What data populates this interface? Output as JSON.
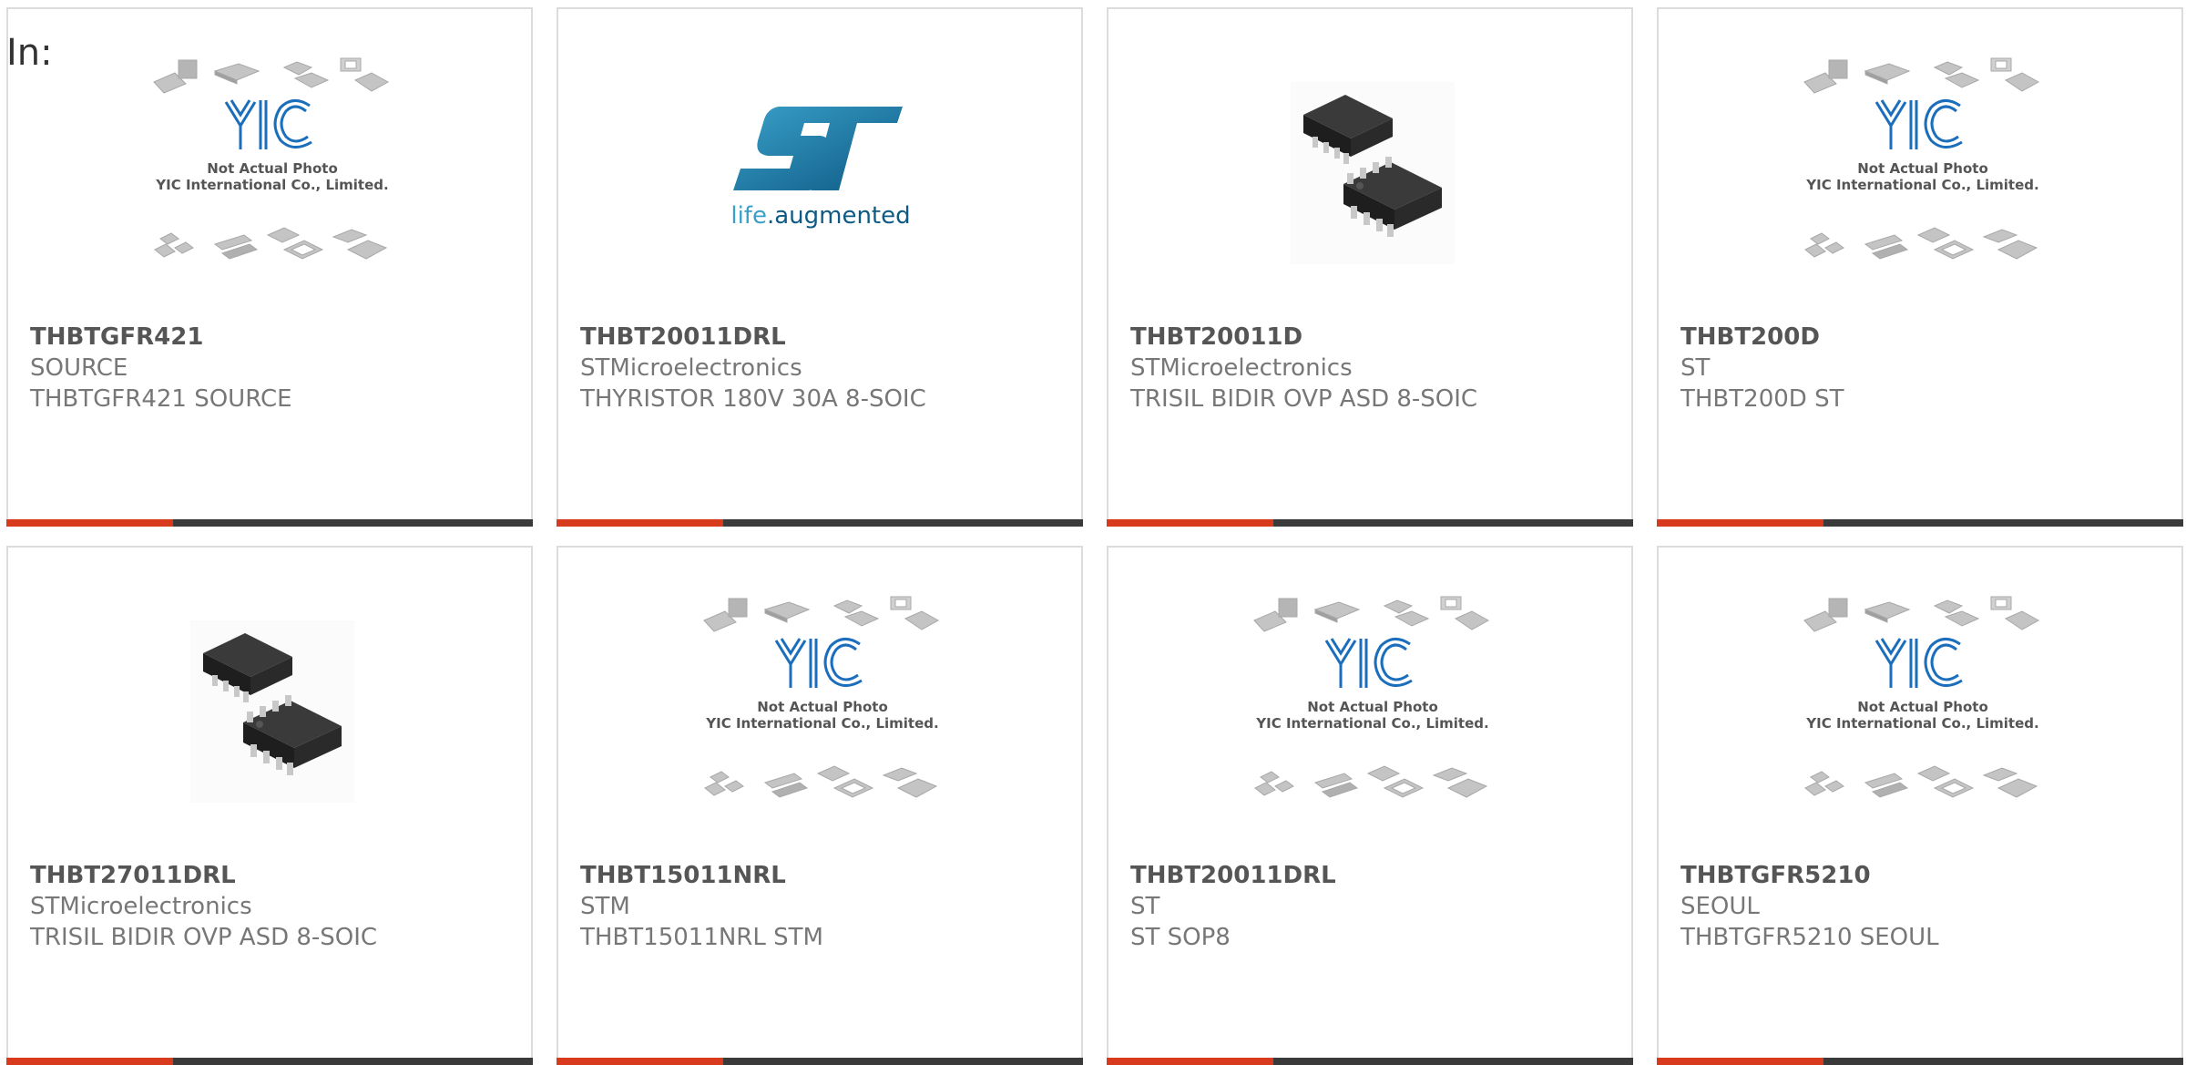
{
  "header": {
    "in_label": "In:"
  },
  "placeholder_text": {
    "line1": "Not Actual Photo",
    "line2": "YIC International Co., Limited."
  },
  "st_logo_tagline": {
    "life": "life",
    "augmented": ".augmented"
  },
  "colors": {
    "accent": "#d83a1e",
    "bar_dark": "#3a3a3a",
    "part_number": "#555555",
    "secondary_text": "#777777",
    "yic_blue": "#1a6ebc",
    "st_blue": "#1d6f9c"
  },
  "products": [
    {
      "part_number": "THBTGFR421",
      "manufacturer": "SOURCE",
      "description": "THBTGFR421 SOURCE",
      "image": "yic-placeholder"
    },
    {
      "part_number": "THBT20011DRL",
      "manufacturer": "STMicroelectronics",
      "description": "THYRISTOR 180V 30A 8-SOIC",
      "image": "st-logo"
    },
    {
      "part_number": "THBT20011D",
      "manufacturer": "STMicroelectronics",
      "description": "TRISIL BIDIR OVP ASD 8-SOIC",
      "image": "soic-chip"
    },
    {
      "part_number": "THBT200D",
      "manufacturer": "ST",
      "description": "THBT200D ST",
      "image": "yic-placeholder"
    },
    {
      "part_number": "THBT27011DRL",
      "manufacturer": "STMicroelectronics",
      "description": "TRISIL BIDIR OVP ASD 8-SOIC",
      "image": "soic-chip"
    },
    {
      "part_number": "THBT15011NRL",
      "manufacturer": "STM",
      "description": "THBT15011NRL STM",
      "image": "yic-placeholder"
    },
    {
      "part_number": "THBT20011DRL",
      "manufacturer": "ST",
      "description": "ST SOP8",
      "image": "yic-placeholder"
    },
    {
      "part_number": "THBTGFR5210",
      "manufacturer": "SEOUL",
      "description": "THBTGFR5210 SEOUL",
      "image": "yic-placeholder"
    }
  ]
}
